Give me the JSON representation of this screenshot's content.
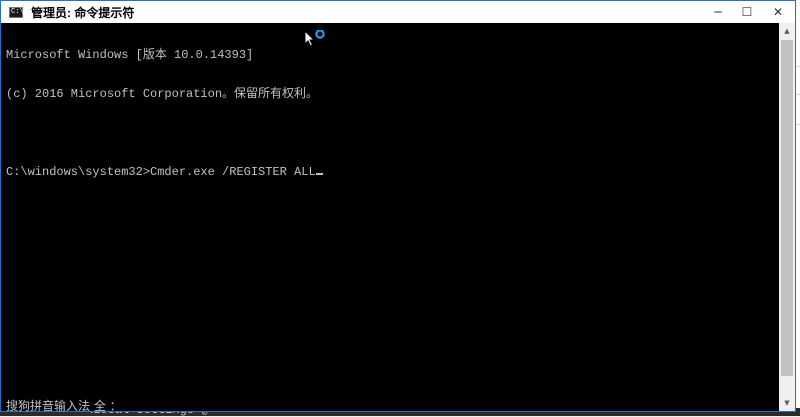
{
  "window": {
    "title": "管理员: 命令提示符",
    "app_icon_text": "C:\\"
  },
  "controls": {
    "minimize": "─",
    "maximize": "☐",
    "close": "✕"
  },
  "console": {
    "lines": [
      "Microsoft Windows [版本 10.0.14393]",
      "(c) 2016 Microsoft Corporation。保留所有权利。",
      "",
      "C:\\windows\\system32>Cmder.exe /REGISTER ALL"
    ]
  },
  "ime": {
    "status": "搜狗拼音输入法 全 ："
  },
  "background": {
    "strip_text": "\\Local Settings'@"
  },
  "scrollbar": {
    "up_arrow": "▲",
    "down_arrow": "▼"
  },
  "colors": {
    "console_bg": "#000000",
    "console_text": "#c0c0c0",
    "window_border": "#1f6fd0",
    "cursor_busy": "#2b8fe0"
  },
  "icons": {
    "app": "console-app-icon",
    "pointer": "busy-arrow-cursor-icon"
  }
}
